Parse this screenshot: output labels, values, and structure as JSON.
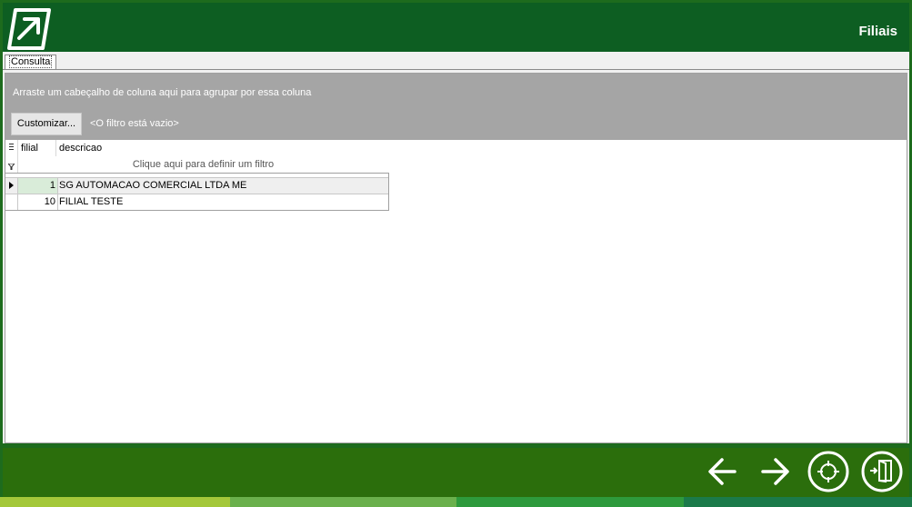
{
  "header": {
    "title": "Filiais",
    "logo": "arrow-logo-icon"
  },
  "tabs": [
    {
      "label": "Consulta",
      "active": true
    }
  ],
  "grid": {
    "group_hint": "Arraste um cabeçalho de coluna aqui para agrupar por essa coluna",
    "customize_label": "Customizar...",
    "filter_empty": "<O filtro está vazio>",
    "filter_row_hint": "Clique aqui para definir um filtro",
    "columns": [
      {
        "label": "filial"
      },
      {
        "label": "descricao"
      }
    ],
    "rows": [
      {
        "filial": "1",
        "descricao": "SG AUTOMACAO COMERCIAL LTDA ME",
        "selected": true
      },
      {
        "filial": "10",
        "descricao": "FILIAL TESTE",
        "selected": false
      }
    ]
  },
  "footer": {
    "buttons": [
      {
        "icon": "arrow-left-icon"
      },
      {
        "icon": "arrow-right-icon"
      },
      {
        "icon": "crosshair-icon"
      },
      {
        "icon": "exit-door-icon"
      }
    ],
    "stripe_colors": [
      "#a4c83a",
      "#6ab04c",
      "#2e9a3c",
      "#1b7a4a"
    ]
  },
  "colors": {
    "header_bg": "#0d5e22",
    "footer_bg": "#2b6e0c",
    "group_panel": "#a5a5a5"
  }
}
